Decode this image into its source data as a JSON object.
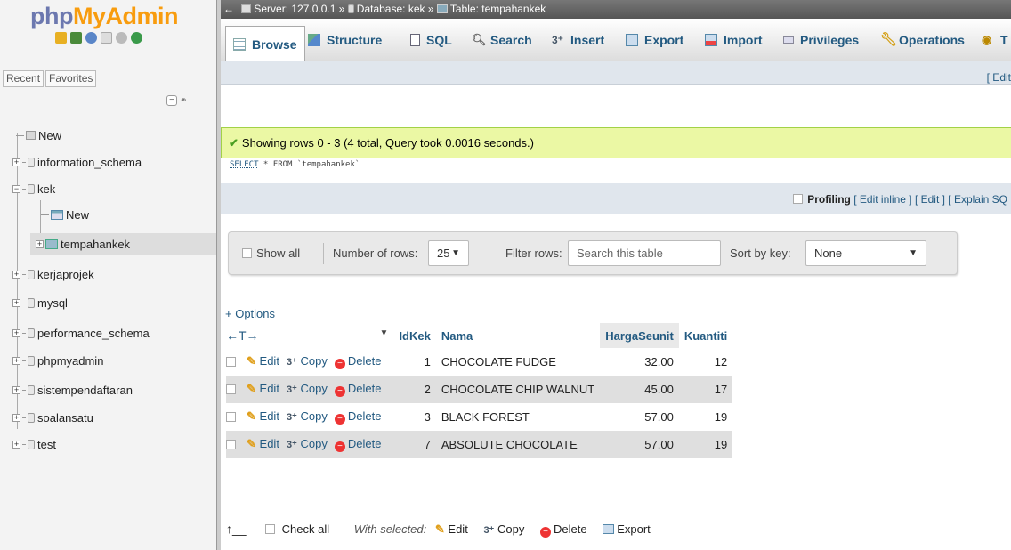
{
  "sidebar": {
    "logo_part1": "php",
    "logo_part2": "MyAdmin",
    "recent": "Recent",
    "favorites": "Favorites",
    "tree": {
      "new": "New",
      "information_schema": "information_schema",
      "kek": "kek",
      "kek_new": "New",
      "tempahankek": "tempahankek",
      "kerjaprojek": "kerjaprojek",
      "mysql": "mysql",
      "performance_schema": "performance_schema",
      "phpmyadmin": "phpmyadmin",
      "sistempendaftaran": "sistempendaftaran",
      "soalansatu": "soalansatu",
      "test": "test"
    }
  },
  "breadcrumb": {
    "server": "Server: 127.0.0.1",
    "sep1": "»",
    "database": "Database: kek",
    "sep2": "»",
    "table": "Table: tempahankek"
  },
  "tabs": {
    "browse": "Browse",
    "structure": "Structure",
    "sql": "SQL",
    "search": "Search",
    "insert": "Insert",
    "export": "Export",
    "import": "Import",
    "privileges": "Privileges",
    "operations": "Operations",
    "more": "T"
  },
  "edit_link": "[ Edit",
  "success_message": "Showing rows 0 - 3 (4 total, Query took 0.0016 seconds.)",
  "sql": {
    "select_kw": "SELECT",
    "rest": " * FROM `tempahankek`"
  },
  "profiling": {
    "label": "Profiling",
    "edit_inline": "[ Edit inline ]",
    "edit": "[ Edit ]",
    "explain": "[ Explain SQ"
  },
  "navbar": {
    "show_all": "Show all",
    "number_of_rows_label": "Number of rows:",
    "number_of_rows_value": "25",
    "filter_rows_label": "Filter rows:",
    "filter_placeholder": "Search this table",
    "sort_by_key_label": "Sort by key:",
    "sort_by_key_value": "None"
  },
  "options_link": "+ Options",
  "table": {
    "columns": [
      "IdKek",
      "Nama",
      "HargaSeunit",
      "Kuantiti"
    ],
    "sort_arrows": "←T→",
    "sort_indicator": "▼",
    "actions": {
      "edit": "Edit",
      "copy": "Copy",
      "delete": "Delete"
    },
    "rows": [
      {
        "idkek": "1",
        "nama": "CHOCOLATE FUDGE",
        "harga": "32.00",
        "kuantiti": "12"
      },
      {
        "idkek": "2",
        "nama": "CHOCOLATE CHIP WALNUT",
        "harga": "45.00",
        "kuantiti": "17"
      },
      {
        "idkek": "3",
        "nama": "BLACK FOREST",
        "harga": "57.00",
        "kuantiti": "19"
      },
      {
        "idkek": "7",
        "nama": "ABSOLUTE CHOCOLATE",
        "harga": "57.00",
        "kuantiti": "19"
      }
    ]
  },
  "footer": {
    "check_all": "Check all",
    "with_selected": "With selected:",
    "edit": "Edit",
    "copy": "Copy",
    "delete": "Delete",
    "export": "Export"
  },
  "colors": {
    "link": "#235a81",
    "success_bg": "#ebf8a4",
    "logo_php": "#6c78af",
    "logo_myadmin": "#f89c0e"
  }
}
